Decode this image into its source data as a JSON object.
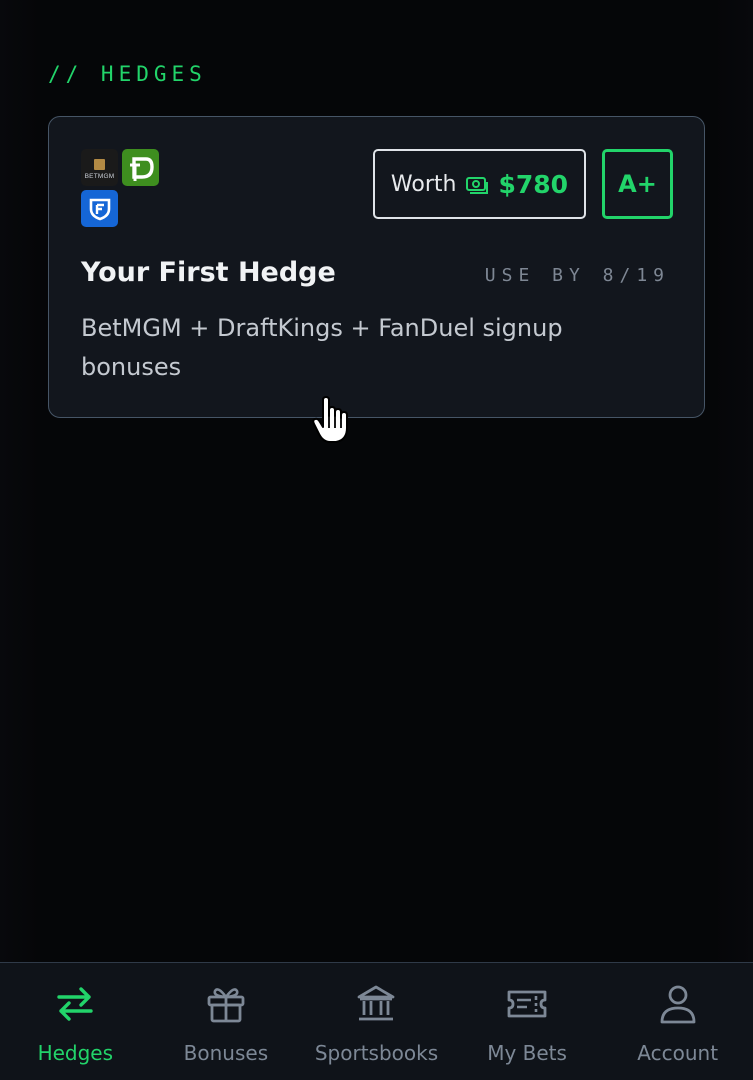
{
  "section": {
    "heading": "// HEDGES"
  },
  "card": {
    "sportsbooks": [
      {
        "name": "BetMGM",
        "logo_text": "BETMGM",
        "icon": "betmgm-logo"
      },
      {
        "name": "DraftKings",
        "icon": "draftkings-logo"
      },
      {
        "name": "FanDuel",
        "icon": "fanduel-logo"
      }
    ],
    "worth_label": "Worth",
    "worth_icon": "money-icon",
    "worth_value": "$780",
    "grade": "A+",
    "title": "Your First Hedge",
    "use_by": "USE BY 8/19",
    "description": "BetMGM + DraftKings + FanDuel signup bonuses"
  },
  "tabs": [
    {
      "label": "Hedges",
      "icon": "swap-arrows-icon",
      "active": true
    },
    {
      "label": "Bonuses",
      "icon": "gift-icon",
      "active": false
    },
    {
      "label": "Sportsbooks",
      "icon": "bank-icon",
      "active": false
    },
    {
      "label": "My Bets",
      "icon": "ticket-icon",
      "active": false
    },
    {
      "label": "Account",
      "icon": "user-icon",
      "active": false
    }
  ],
  "colors": {
    "accent": "#22d46a",
    "background": "#050608",
    "card": "#12161d",
    "card_border": "#465566",
    "muted_text": "#7d8896"
  }
}
